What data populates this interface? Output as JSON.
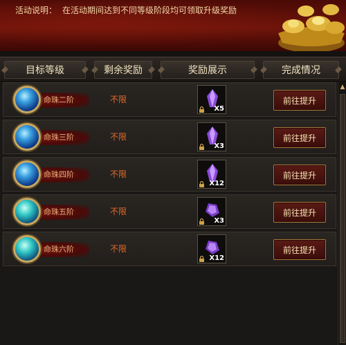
{
  "banner": {
    "label": "活动说明：",
    "text": "在活动期间达到不同等级阶段均可领取升级奖励"
  },
  "header": {
    "col_target": "目标等级",
    "col_remain": "剩余奖励",
    "col_reward": "奖励展示",
    "col_status": "完成情况"
  },
  "rows": [
    {
      "level": "命珠二阶",
      "remain": "不限",
      "qty": "X5",
      "button": "前往提升"
    },
    {
      "level": "命珠三阶",
      "remain": "不限",
      "qty": "X3",
      "button": "前往提升"
    },
    {
      "level": "命珠四阶",
      "remain": "不限",
      "qty": "X12",
      "button": "前往提升"
    },
    {
      "level": "命珠五阶",
      "remain": "不限",
      "qty": "X3",
      "button": "前往提升"
    },
    {
      "level": "命珠六阶",
      "remain": "不限",
      "qty": "X12",
      "button": "前往提升"
    }
  ],
  "colors": {
    "remain_text": "#e06a2a",
    "button_border": "#a57a3a",
    "banner_red": "#6e140a"
  },
  "icons": {
    "orb": "blue-orb-icon",
    "crystal": "purple-crystal-icon",
    "lock": "lock-icon",
    "scroll_up": "scroll-up-arrow-icon"
  }
}
